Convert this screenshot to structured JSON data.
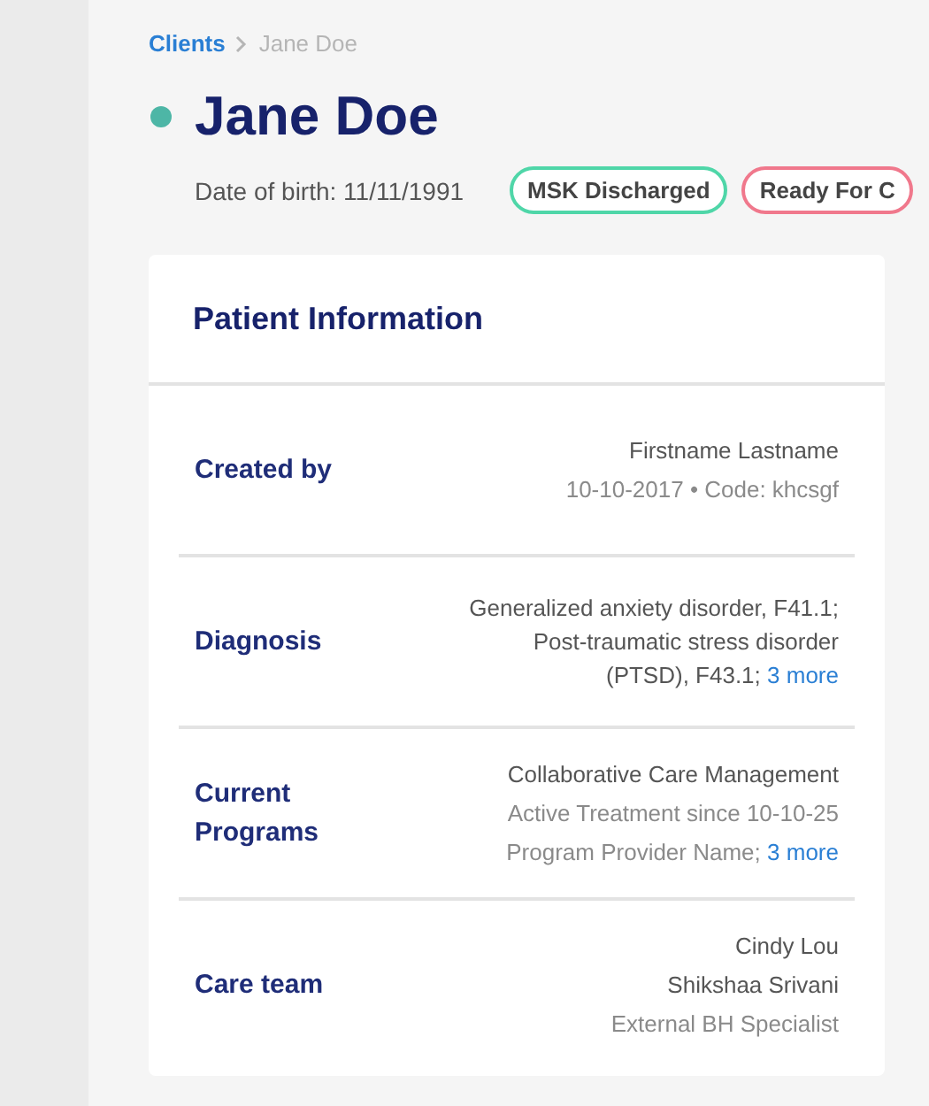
{
  "breadcrumb": {
    "parent": "Clients",
    "current": "Jane Doe"
  },
  "patient": {
    "name": "Jane Doe",
    "color": "#4db6a6",
    "date_of_birth": "Date of birth: 11/11/1991"
  },
  "tags": [
    {
      "label": "MSK Discharged",
      "color": "#4fd6a8"
    },
    {
      "label": "Ready For C",
      "color": "#f0788c"
    }
  ],
  "card": {
    "title": "Patient Information",
    "rows": [
      {
        "label": "Created by",
        "lines": [
          {
            "text": "Firstname Lastname",
            "kind": "primary"
          },
          {
            "text": "10-10-2017 • Code: khcsgf",
            "kind": "secondary"
          }
        ]
      },
      {
        "label": "Diagnosis",
        "lines": [
          {
            "text": "Generalized anxiety disorder, F41.1; Post-traumatic stress disorder (PTSD), F43.1;",
            "kind": "primary",
            "link": "3 more"
          }
        ]
      },
      {
        "label": "Current Programs",
        "lines": [
          {
            "text": "Collaborative Care Management",
            "kind": "primary"
          },
          {
            "text": "Active Treatment since 10-10-25",
            "kind": "secondary"
          },
          {
            "text": "Program Provider Name;",
            "kind": "secondary",
            "link": "3 more"
          }
        ]
      },
      {
        "label": "Care team",
        "lines": [
          {
            "text": "Cindy Lou",
            "kind": "primary"
          },
          {
            "text": "Shikshaa Srivani",
            "kind": "primary"
          },
          {
            "text": "External BH Specialist",
            "kind": "secondary"
          }
        ]
      }
    ]
  }
}
